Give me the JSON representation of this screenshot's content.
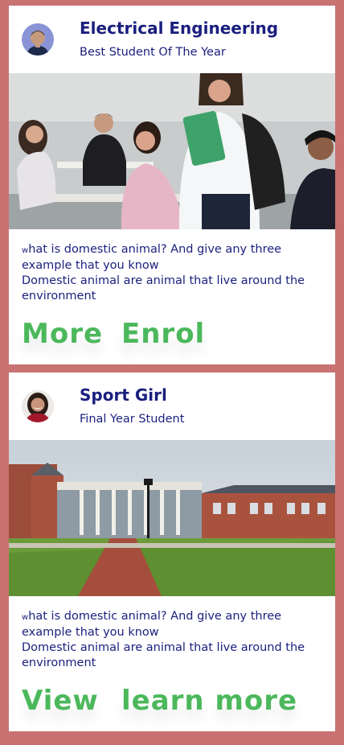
{
  "cards": [
    {
      "title": "Electrical Engineering",
      "subtitle": "Best Student Of The Year",
      "question_lead": "w",
      "question_rest": "hat is domestic animal? And give any three example that you know",
      "answer": "Domestic animal are animal that live around the environment",
      "button_primary": "More",
      "button_secondary": "Enrol",
      "image": "classroom-students-photo",
      "avatar": "male-avatar"
    },
    {
      "title": "Sport Girl",
      "subtitle": "Final Year Student",
      "question_lead": "w",
      "question_rest": "hat is domestic animal? And give any three example that you know",
      "answer": "Domestic animal are animal that live around the environment",
      "button_primary": "View",
      "button_secondary": "learn more",
      "image": "university-campus-photo",
      "avatar": "female-avatar"
    }
  ],
  "colors": {
    "background": "#c97272",
    "card": "#ffffff",
    "heading": "#1a1f7e",
    "button": "#4cb85c"
  }
}
